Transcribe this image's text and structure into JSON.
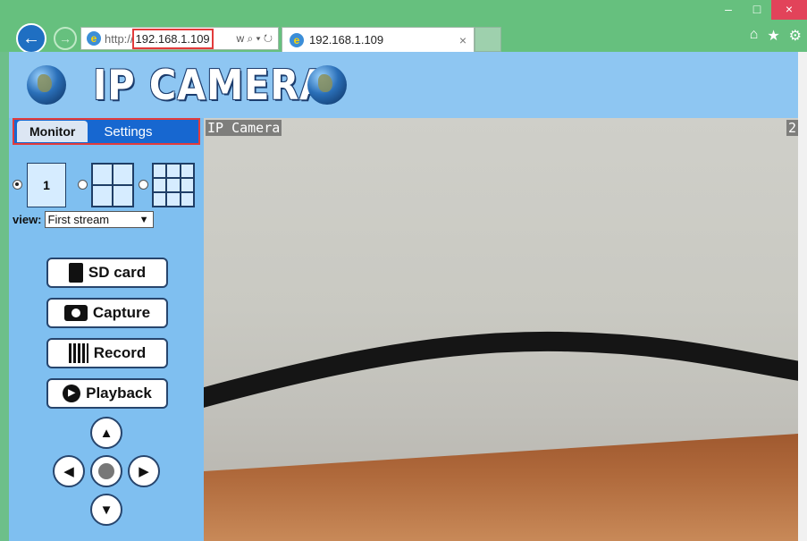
{
  "browser": {
    "window_controls": {
      "minimize": "–",
      "maximize": "□",
      "close": "×"
    },
    "address": {
      "protocol": "http://",
      "host": "192.168.1.109",
      "tools": "w ⌕ ▾ ↻"
    },
    "tab_title": "192.168.1.109",
    "tab_close": "×",
    "right_tools": {
      "home": "⌂",
      "favorites": "★",
      "settings": "⚙"
    }
  },
  "app": {
    "logo": "IP CAMERA",
    "tabs": {
      "monitor": "Monitor",
      "settings": "Settings"
    },
    "split": {
      "single_label": "1",
      "selected": "1"
    },
    "view": {
      "label": "view:",
      "value": "First stream"
    },
    "buttons": {
      "sd_card": "SD card",
      "capture": "Capture",
      "record": "Record",
      "playback": "Playback"
    },
    "ptz": {
      "up": "▲",
      "down": "▼",
      "left": "◀",
      "right": "▶"
    },
    "video": {
      "osd_left": "IP Camera",
      "osd_right": "2"
    }
  }
}
